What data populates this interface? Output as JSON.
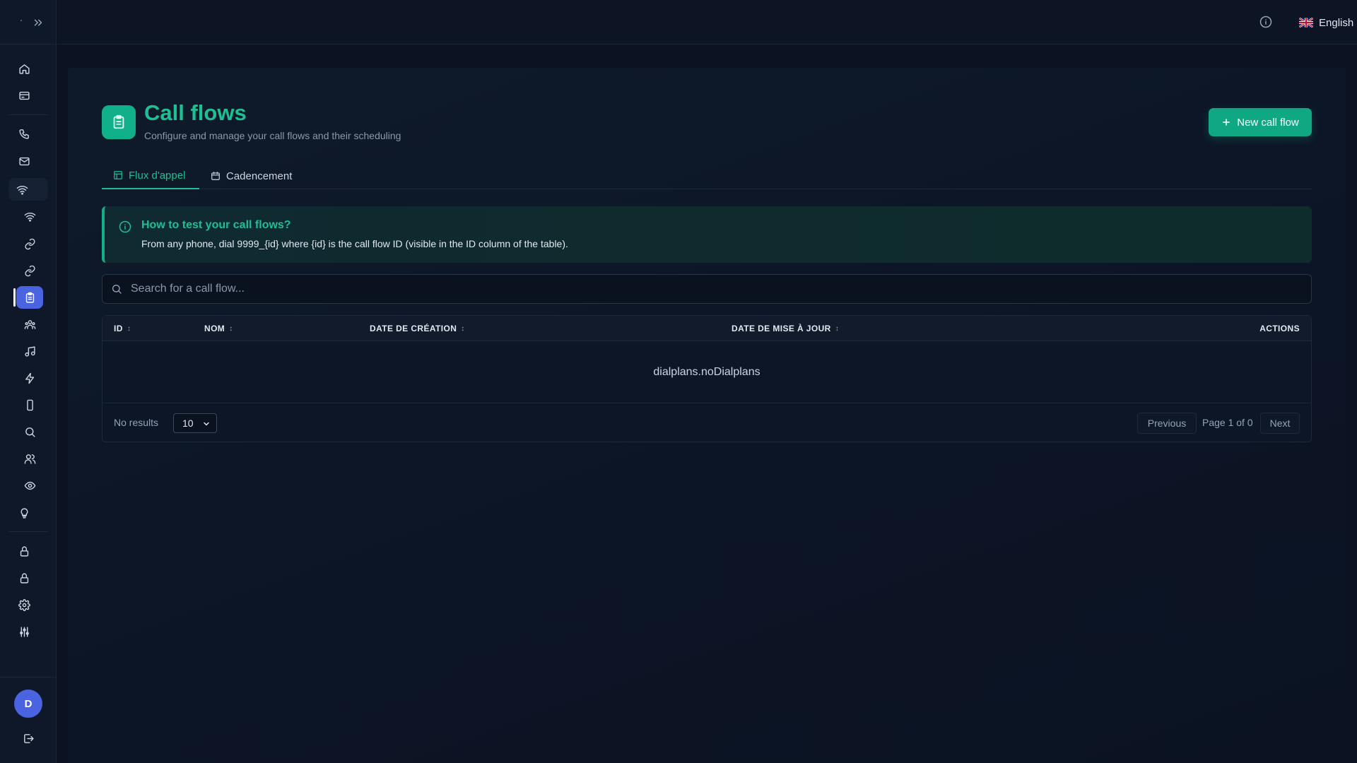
{
  "sidebar": {
    "items": [
      {
        "icon": "home-icon"
      },
      {
        "icon": "billing-icon"
      },
      {
        "icon": "phone-icon"
      },
      {
        "icon": "mail-icon"
      },
      {
        "icon": "wifi-icon"
      },
      {
        "icon": "wifi-icon"
      },
      {
        "icon": "link-icon"
      },
      {
        "icon": "link-icon"
      },
      {
        "icon": "clipboard-icon",
        "active": true
      },
      {
        "icon": "team-icon"
      },
      {
        "icon": "music-icon"
      },
      {
        "icon": "lightning-icon"
      },
      {
        "icon": "smartphone-icon"
      },
      {
        "icon": "search-icon"
      },
      {
        "icon": "users-icon"
      },
      {
        "icon": "eye-icon"
      },
      {
        "icon": "bulb-icon"
      },
      {
        "icon": "lock-icon"
      },
      {
        "icon": "lock-icon"
      },
      {
        "icon": "gear-icon"
      },
      {
        "icon": "sliders-icon"
      }
    ],
    "avatar_initial": "D"
  },
  "topbar": {
    "language": "English"
  },
  "page": {
    "title": "Call flows",
    "subtitle": "Configure and manage your call flows and their scheduling",
    "new_button": "New call flow"
  },
  "tabs": [
    {
      "label": "Flux d'appel",
      "active": true
    },
    {
      "label": "Cadencement",
      "active": false
    }
  ],
  "alert": {
    "title": "How to test your call flows?",
    "text": "From any phone, dial 9999_{id} where {id} is the call flow ID (visible in the ID column of the table)."
  },
  "search": {
    "placeholder": "Search for a call flow...",
    "value": ""
  },
  "table": {
    "columns": [
      "ID",
      "NOM",
      "DATE DE CRÉATION",
      "DATE DE MISE À JOUR",
      "ACTIONS"
    ],
    "empty_text": "dialplans.noDialplans",
    "no_results": "No results",
    "page_size": "10",
    "previous": "Previous",
    "page_info": "Page 1 of 0",
    "next": "Next"
  },
  "colors": {
    "accent": "#10b08a",
    "sidebar_active": "#4a63e0",
    "background": "#0b1322"
  }
}
